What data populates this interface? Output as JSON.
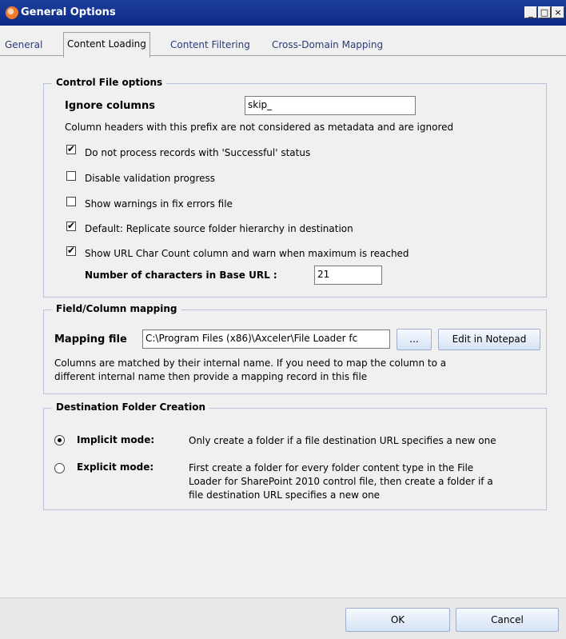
{
  "window": {
    "title": "General Options",
    "minimize_label": "_",
    "maximize_label": "□",
    "close_label": "×"
  },
  "tabs": [
    {
      "label": "General"
    },
    {
      "label": "Content Loading"
    },
    {
      "label": "Content Filtering"
    },
    {
      "label": "Cross-Domain Mapping"
    }
  ],
  "control_file": {
    "legend": "Control File options",
    "ignore_columns_label": "Ignore columns",
    "ignore_columns_value": "skip_",
    "prefix_note": "Column headers with this prefix are not considered as metadata and are ignored",
    "options": [
      {
        "label": "Do not process records with 'Successful' status",
        "checked": true
      },
      {
        "label": "Disable validation progress",
        "checked": false
      },
      {
        "label": "Show warnings in fix errors file",
        "checked": false
      },
      {
        "label": "Default: Replicate source folder hierarchy in destination",
        "checked": true
      },
      {
        "label": "Show URL Char Count column and warn when maximum is reached",
        "checked": true
      }
    ],
    "base_url_label": "Number of characters in Base URL :",
    "base_url_value": "21"
  },
  "field_mapping": {
    "legend": "Field/Column mapping",
    "mapping_file_label": "Mapping file",
    "mapping_file_value": "C:\\Program Files (x86)\\Axceler\\File Loader fc",
    "browse_label": "...",
    "edit_label": "Edit in Notepad",
    "note_line1": "Columns are matched by their internal name. If you need to map the column to a",
    "note_line2": "different internal name then provide a mapping record in this file"
  },
  "destination": {
    "legend": "Destination Folder Creation",
    "implicit_label": "Implicit mode:",
    "implicit_desc": "Only create a folder if a file destination URL specifies a new one",
    "explicit_label": "Explicit mode:",
    "explicit_desc_line1": "First create a folder for every folder content type in the File",
    "explicit_desc_line2": "Loader for SharePoint 2010 control file, then create a folder if a",
    "explicit_desc_line3": "file destination URL specifies a new one",
    "selected": "implicit"
  },
  "footer": {
    "ok_label": "OK",
    "cancel_label": "Cancel"
  }
}
